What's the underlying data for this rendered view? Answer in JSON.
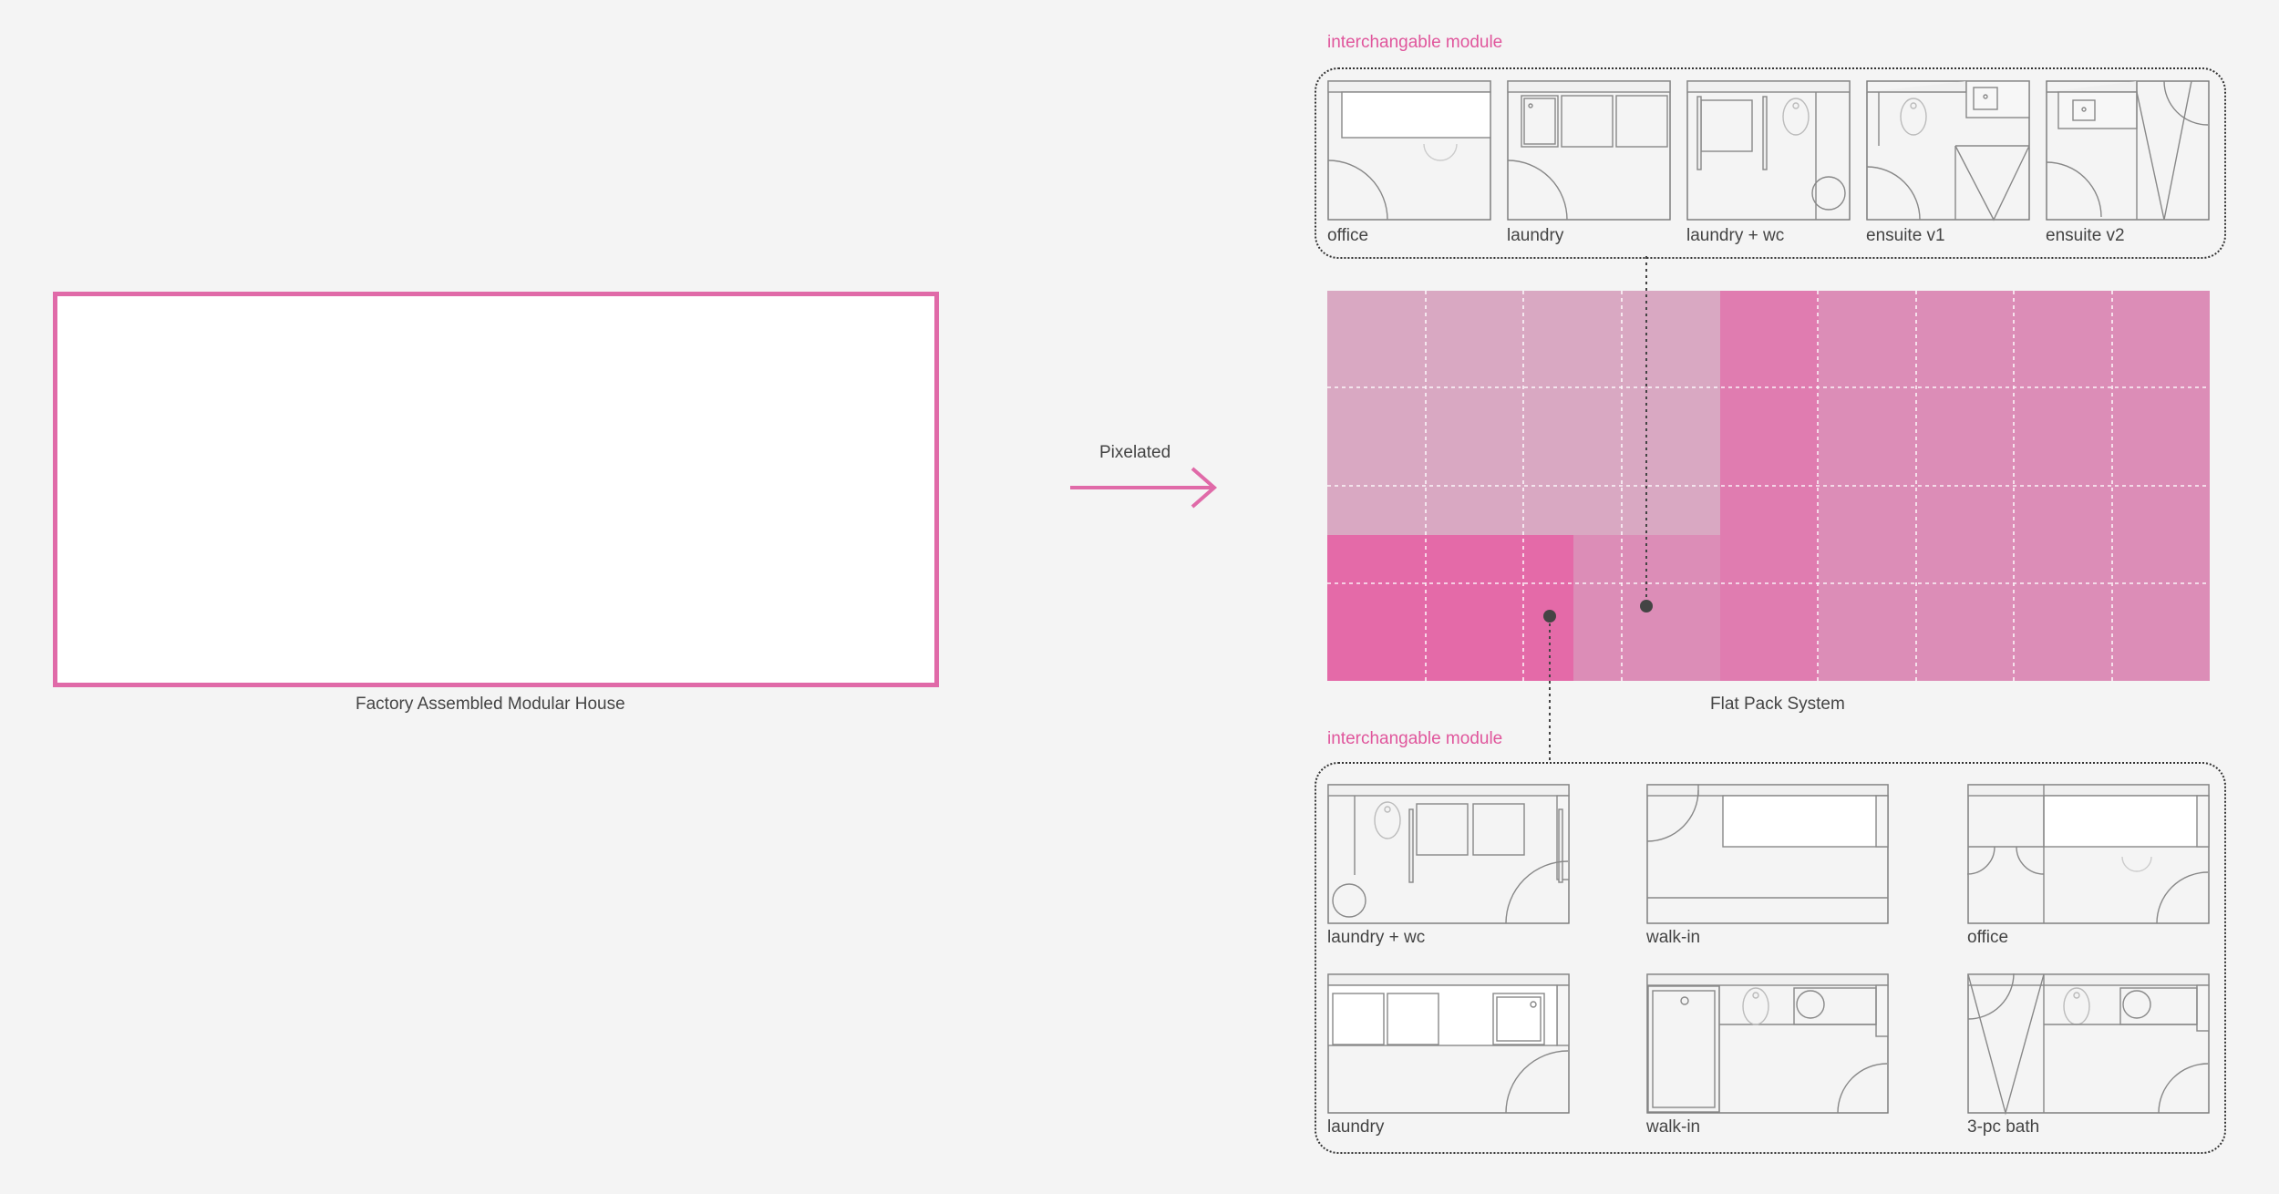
{
  "house": {
    "caption": "Factory Assembled Modular House"
  },
  "arrow": {
    "label": "Pixelated"
  },
  "flat_pack": {
    "caption": "Flat Pack System"
  },
  "top_group": {
    "label": "interchangable module",
    "modules": [
      {
        "label": "office",
        "kind": "office_a"
      },
      {
        "label": "laundry",
        "kind": "laundry_a"
      },
      {
        "label": "laundry + wc",
        "kind": "laundry_wc_a"
      },
      {
        "label": "ensuite v1",
        "kind": "ensuite_v1"
      },
      {
        "label": "ensuite v2",
        "kind": "ensuite_v2"
      }
    ]
  },
  "bottom_group": {
    "label": "interchangable module",
    "modules": [
      {
        "label": "laundry + wc",
        "kind": "laundry_wc_b"
      },
      {
        "label": "walk-in",
        "kind": "walkin_a"
      },
      {
        "label": "office",
        "kind": "office_b"
      },
      {
        "label": "laundry",
        "kind": "laundry_b"
      },
      {
        "label": "walk-in",
        "kind": "walkin_b"
      },
      {
        "label": "3-pc bath",
        "kind": "bath_3pc"
      }
    ]
  },
  "colors": {
    "background": "#f4f4f4",
    "accent": "#e06aa8",
    "label_pink": "#e0569c",
    "grid_light": "#d9a8c2",
    "grid_medium": "#dc8db7",
    "grid_strong": "#e07cb0",
    "grid_hot": "#e46aa8"
  }
}
